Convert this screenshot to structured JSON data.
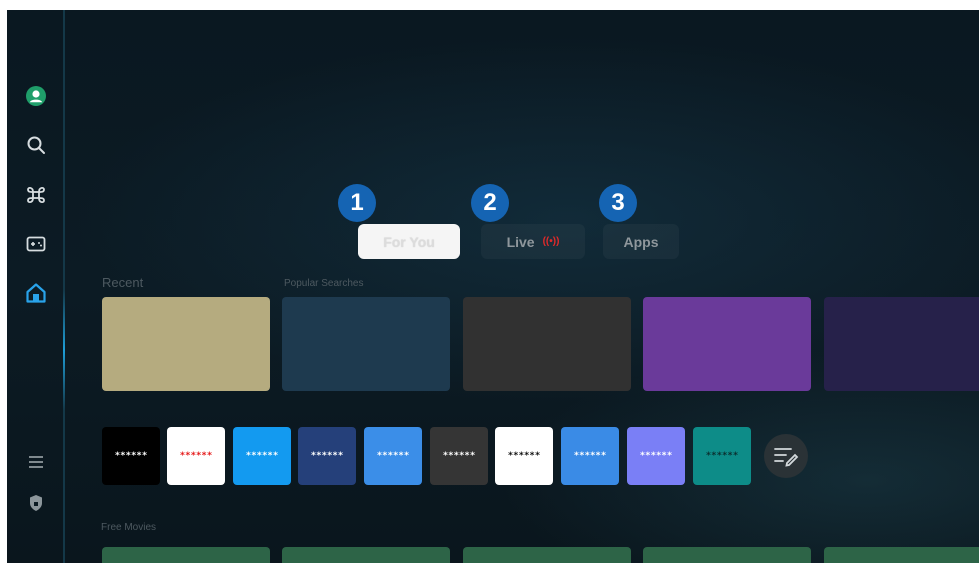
{
  "sidebar": {
    "items": [
      {
        "name": "profile",
        "icon": "profile-icon"
      },
      {
        "name": "search",
        "icon": "search-icon"
      },
      {
        "name": "ambient",
        "icon": "ambient-icon"
      },
      {
        "name": "game",
        "icon": "game-icon"
      },
      {
        "name": "home",
        "icon": "home-icon",
        "active": true
      },
      {
        "name": "menu",
        "icon": "menu-icon"
      },
      {
        "name": "privacy",
        "icon": "shield-icon"
      }
    ]
  },
  "tabs": [
    {
      "number": "1",
      "label": "For You",
      "active": true
    },
    {
      "number": "2",
      "label": "Live",
      "badge": "((•))"
    },
    {
      "number": "3",
      "label": "Apps"
    }
  ],
  "sections": {
    "recent": "Recent",
    "popular": "Popular Searches",
    "free_movies": "Free Movies"
  },
  "cards": [
    {
      "color": "#b5ab7f"
    },
    {
      "color": "#1e3a4f"
    },
    {
      "color": "#313131"
    },
    {
      "color": "#6a3a9a"
    },
    {
      "color": "#26214a"
    }
  ],
  "apps": [
    {
      "label": "******",
      "bg": "#000000",
      "fg": "#ffffff"
    },
    {
      "label": "******",
      "bg": "#ffffff",
      "fg": "#e51a1a"
    },
    {
      "label": "******",
      "bg": "#139af0",
      "fg": "#ffffff"
    },
    {
      "label": "******",
      "bg": "#25407a",
      "fg": "#ffffff"
    },
    {
      "label": "******",
      "bg": "#3b8ee8",
      "fg": "#ffffff"
    },
    {
      "label": "******",
      "bg": "#353535",
      "fg": "#ffffff"
    },
    {
      "label": "******",
      "bg": "#ffffff",
      "fg": "#111111"
    },
    {
      "label": "******",
      "bg": "#3a8be6",
      "fg": "#ffffff"
    },
    {
      "label": "******",
      "bg": "#7a7ff6",
      "fg": "#ffffff"
    },
    {
      "label": "******",
      "bg": "#0d8c88",
      "fg": "#0b2f2f"
    }
  ],
  "edit_apps_icon": "edit-list-icon",
  "colors": {
    "accent": "#1564b3",
    "home_active": "#29a3ea",
    "live_indicator": "#e22a2a"
  }
}
